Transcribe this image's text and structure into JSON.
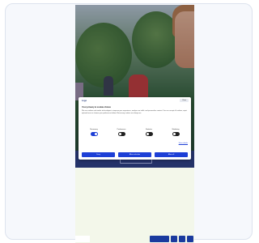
{
  "consent": {
    "brand": "Logo",
    "close": "Close",
    "title": "Your privacy & cookie choice",
    "body": "We use cookies and similar technologies to improve your experience, analyse our traffic and personalise content. You can accept all cookies, reject optional ones or choose your preferences below. Necessary cookies are always on.",
    "toggles": [
      {
        "label": "Necessary",
        "on": true
      },
      {
        "label": "Preferences",
        "on": false
      },
      {
        "label": "Statistics",
        "on": false
      },
      {
        "label": "Marketing",
        "on": false
      }
    ],
    "details_link": "Show details",
    "buttons": {
      "deny": "Deny",
      "allow_selection": "Allow selection",
      "allow_all": "Allow all"
    }
  },
  "colors": {
    "accent": "#1d3fd6",
    "band": "#2d3d78",
    "page_bg": "#f3f7ea",
    "footer": "#1a3a9e"
  }
}
